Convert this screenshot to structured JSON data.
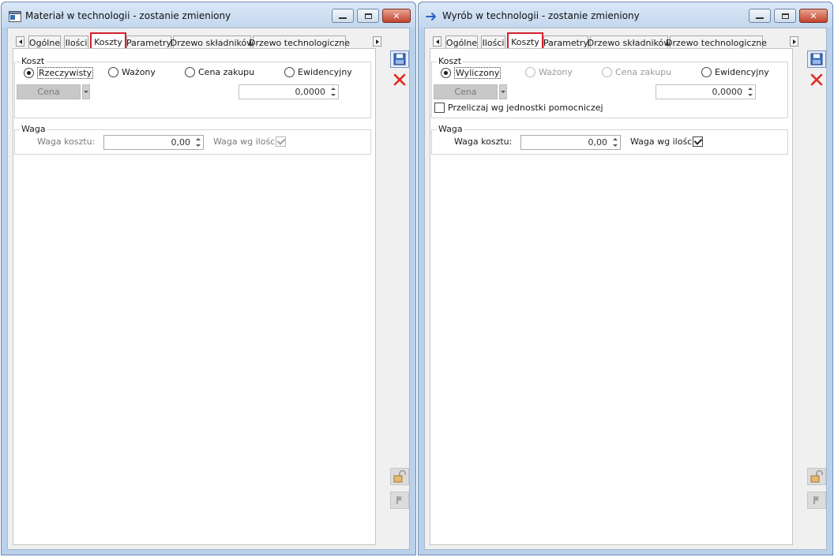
{
  "left": {
    "title": "Materiał w technologii - zostanie zmieniony",
    "tabs": [
      "Ogólne",
      "Ilości",
      "Koszty",
      "Parametry",
      "Drzewo składników",
      "Drzewo technologiczne"
    ],
    "koszt": {
      "label": "Koszt",
      "radios": [
        "Rzeczywisty",
        "Ważony",
        "Cena zakupu",
        "Ewidencyjny"
      ],
      "cena_button": "Cena",
      "value": "0,0000"
    },
    "waga": {
      "label": "Waga",
      "waga_kosztu_label": "Waga kosztu:",
      "waga_kosztu_value": "0,00",
      "waga_wg_ilosci_label": "Waga wg ilości:"
    }
  },
  "right": {
    "title": "Wyrób w technologii - zostanie zmieniony",
    "tabs": [
      "Ogólne",
      "Ilości",
      "Koszty",
      "Parametry",
      "Drzewo składników",
      "Drzewo technologiczne"
    ],
    "koszt": {
      "label": "Koszt",
      "radios": [
        "Wyliczony",
        "Ważony",
        "Cena zakupu",
        "Ewidencyjny"
      ],
      "cena_button": "Cena",
      "value": "0,0000",
      "przeliczaj_label": "Przeliczaj wg jednostki pomocniczej"
    },
    "waga": {
      "label": "Waga",
      "waga_kosztu_label": "Waga kosztu:",
      "waga_kosztu_value": "0,00",
      "waga_wg_ilosci_label": "Waga wg ilości:"
    }
  },
  "colors": {
    "active_tab_highlight": "#d32030",
    "window_frame": "#b9d1ea",
    "close_button": "#c2432b"
  },
  "icons": {
    "left_title": "window-doc-icon",
    "right_title": "arrow-right-icon",
    "save": "save-icon",
    "cancel": "close-x-icon",
    "lock": "padlock-icon",
    "flag": "flag-icon"
  }
}
